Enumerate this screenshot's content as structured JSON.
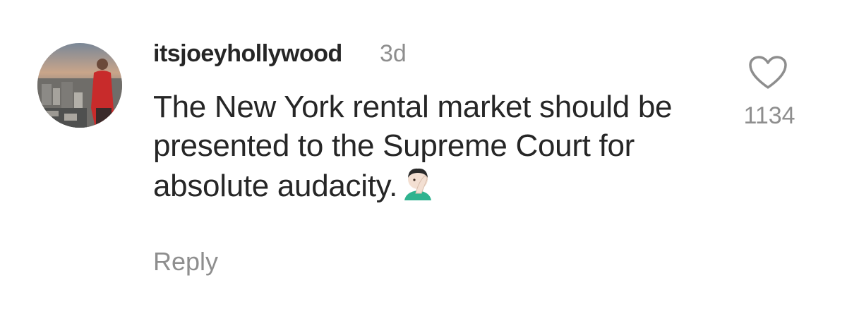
{
  "comment": {
    "username": "itsjoeyhollywood",
    "timestamp": "3d",
    "text_lines": [
      "The New York rental market should be",
      "presented to the Supreme Court for",
      "absolute audacity."
    ],
    "emoji": "face-palm-emoji",
    "reply_label": "Reply",
    "like_icon": "heart-outline-icon",
    "like_count": "1134"
  }
}
